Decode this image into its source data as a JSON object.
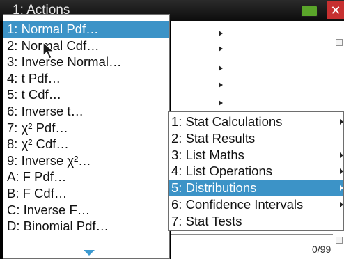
{
  "header": {
    "title": "1: Actions",
    "icons": {
      "menu": "wrench-icon",
      "battery": "battery-icon",
      "close": "close-icon"
    }
  },
  "status": {
    "counter": "0/99"
  },
  "distributions_menu": {
    "items": [
      "1: Normal Pdf…",
      "2: Normal Cdf…",
      "3: Inverse Normal…",
      "4: t Pdf…",
      "5: t Cdf…",
      "6: Inverse t…",
      "7: χ² Pdf…",
      "8: χ² Cdf…",
      "9: Inverse χ²…",
      "A: F Pdf…",
      "B: F Cdf…",
      "C: Inverse F…",
      "D: Binomial Pdf…"
    ],
    "selected_index": 0,
    "more_icon": "scroll-down-arrow-icon"
  },
  "stat_menu": {
    "items": [
      "1: Stat Calculations",
      "2: Stat Results",
      "3: List Maths",
      "4: List Operations",
      "5: Distributions",
      "6: Confidence Intervals",
      "7: Stat Tests"
    ],
    "selected_index": 4
  },
  "colors": {
    "selection": "#3c93c7",
    "background": "#000000",
    "battery": "#5aa52a",
    "close": "#c73030"
  }
}
